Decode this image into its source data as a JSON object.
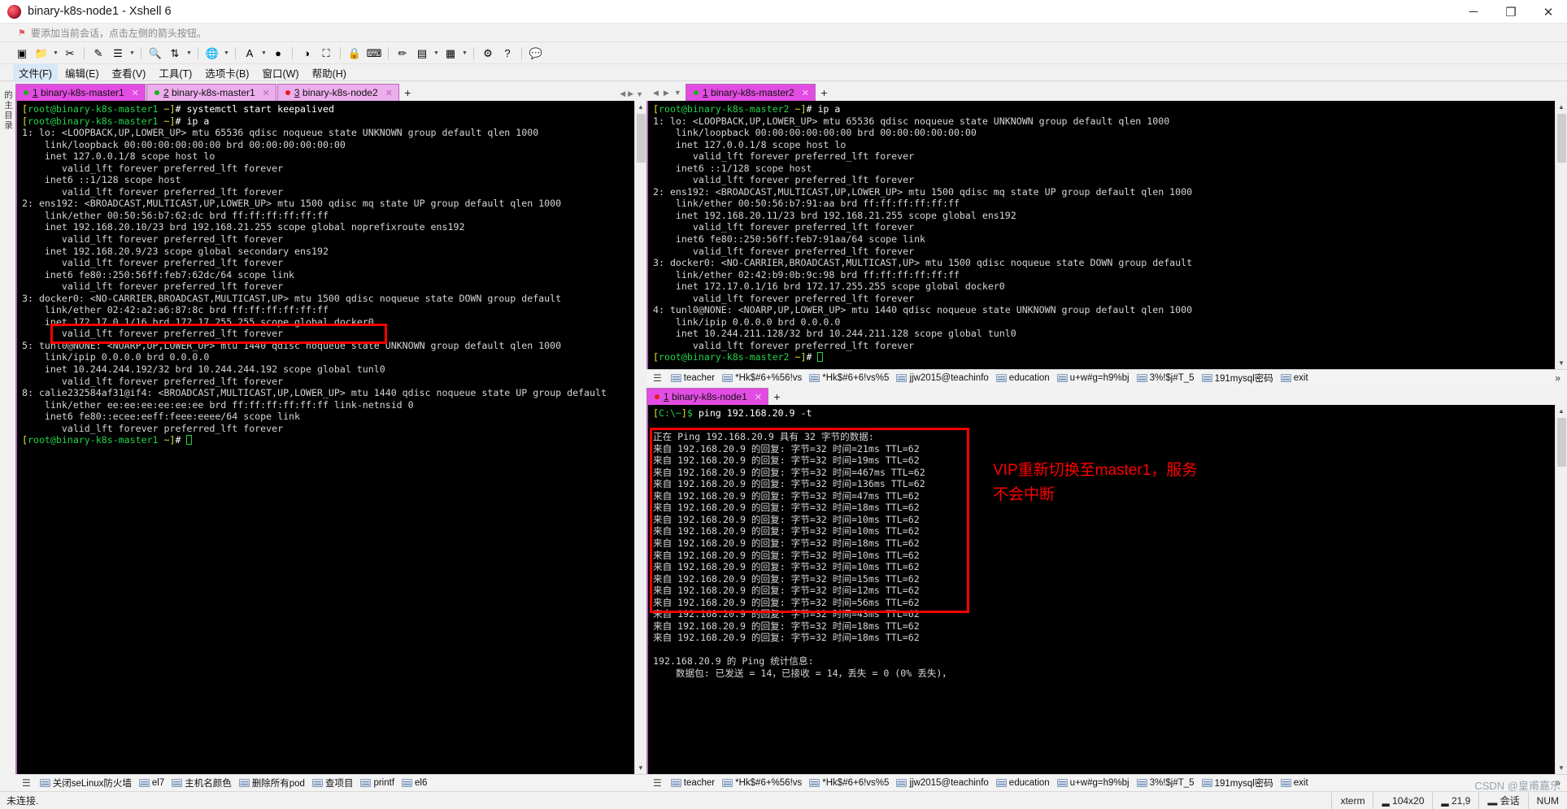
{
  "window": {
    "title": "binary-k8s-node1 - Xshell 6",
    "icon": "xshell-logo-icon",
    "minimize": "─",
    "maximize": "❐",
    "close": "✕"
  },
  "notice": {
    "icon": "red-flag-icon",
    "text": "要添加当前会话，点击左侧的箭头按钮。"
  },
  "toolbar": {
    "buttons": [
      {
        "name": "new-session",
        "glyph": "▣"
      },
      {
        "name": "open-folder",
        "glyph": "📁",
        "caret": true
      },
      {
        "name": "copy-session",
        "glyph": "✂"
      },
      {
        "name": "paste-session",
        "glyph": "✎"
      },
      {
        "name": "log-session",
        "glyph": "☰",
        "caret": true
      },
      {
        "name": "find",
        "glyph": "🔍"
      },
      {
        "name": "transfer-file",
        "glyph": "⇅",
        "caret": true
      },
      {
        "name": "global-tunnel",
        "glyph": "🌐",
        "caret": true
      },
      {
        "name": "font-size",
        "glyph": "A",
        "caret": true
      },
      {
        "name": "xshell",
        "glyph": "●"
      },
      {
        "name": "xftp",
        "glyph": "◑"
      },
      {
        "name": "fullscreen",
        "glyph": "⛶"
      },
      {
        "name": "lock",
        "glyph": "🔒"
      },
      {
        "name": "keyboard",
        "glyph": "⌨"
      },
      {
        "name": "highlight-pen",
        "glyph": "✏"
      },
      {
        "name": "compose",
        "glyph": "▤",
        "caret": true
      },
      {
        "name": "layout",
        "glyph": "▦",
        "caret": true
      },
      {
        "name": "settings",
        "glyph": "⚙"
      },
      {
        "name": "help",
        "glyph": "?"
      },
      {
        "name": "chat",
        "glyph": "💬"
      }
    ]
  },
  "menubar": {
    "items": [
      {
        "label": "文件(F)",
        "active": true
      },
      {
        "label": "编辑(E)",
        "active": false
      },
      {
        "label": "查看(V)",
        "active": false
      },
      {
        "label": "工具(T)",
        "active": false
      },
      {
        "label": "选项卡(B)",
        "active": false
      },
      {
        "label": "窗口(W)",
        "active": false
      },
      {
        "label": "帮助(H)",
        "active": false
      }
    ]
  },
  "vstrip": {
    "label": "的主目录"
  },
  "left_pane": {
    "tabs": [
      {
        "num": "1",
        "label": "binary-k8s-master1",
        "active": true,
        "dot": "green"
      },
      {
        "num": "2",
        "label": "binary-k8s-master1",
        "active": false,
        "dot": "green"
      },
      {
        "num": "3",
        "label": "binary-k8s-node2",
        "active": false,
        "dot": "red"
      }
    ],
    "add_label": "+",
    "nav_prev": "◀",
    "nav_next": "▶",
    "nav_menu": "▼",
    "prompt_user": "[root@binary-k8s-master1",
    "terminal_lines": [
      "[root@binary-k8s-master1 ~]# systemctl start keepalived",
      "[root@binary-k8s-master1 ~]# ip a",
      "1: lo: <LOOPBACK,UP,LOWER_UP> mtu 65536 qdisc noqueue state UNKNOWN group default qlen 1000",
      "    link/loopback 00:00:00:00:00:00 brd 00:00:00:00:00:00",
      "    inet 127.0.0.1/8 scope host lo",
      "       valid_lft forever preferred_lft forever",
      "    inet6 ::1/128 scope host",
      "       valid_lft forever preferred_lft forever",
      "2: ens192: <BROADCAST,MULTICAST,UP,LOWER_UP> mtu 1500 qdisc mq state UP group default qlen 1000",
      "    link/ether 00:50:56:b7:62:dc brd ff:ff:ff:ff:ff:ff",
      "    inet 192.168.20.10/23 brd 192.168.21.255 scope global noprefixroute ens192",
      "       valid_lft forever preferred_lft forever",
      "    inet 192.168.20.9/23 scope global secondary ens192",
      "       valid_lft forever preferred_lft forever",
      "    inet6 fe80::250:56ff:feb7:62dc/64 scope link",
      "       valid_lft forever preferred_lft forever",
      "3: docker0: <NO-CARRIER,BROADCAST,MULTICAST,UP> mtu 1500 qdisc noqueue state DOWN group default",
      "    link/ether 02:42:a2:a6:87:8c brd ff:ff:ff:ff:ff:ff",
      "    inet 172.17.0.1/16 brd 172.17.255.255 scope global docker0",
      "       valid_lft forever preferred_lft forever",
      "5: tunl0@NONE: <NOARP,UP,LOWER_UP> mtu 1440 qdisc noqueue state UNKNOWN group default qlen 1000",
      "    link/ipip 0.0.0.0 brd 0.0.0.0",
      "    inet 10.244.244.192/32 brd 10.244.244.192 scope global tunl0",
      "       valid_lft forever preferred_lft forever",
      "8: calie232584af31@if4: <BROADCAST,MULTICAST,UP,LOWER_UP> mtu 1440 qdisc noqueue state UP group default",
      "    link/ether ee:ee:ee:ee:ee:ee brd ff:ff:ff:ff:ff:ff link-netnsid 0",
      "    inet6 fe80::ecee:eeff:feee:eeee/64 scope link",
      "       valid_lft forever preferred_lft forever"
    ],
    "final_prompt": "[root@binary-k8s-master1 ~]# ",
    "quickbar": [
      {
        "label": "关闭seLinux防火墙"
      },
      {
        "label": "el7"
      },
      {
        "label": "主机名颜色"
      },
      {
        "label": "删除所有pod"
      },
      {
        "label": "查项目"
      },
      {
        "label": "printf"
      },
      {
        "label": "el6"
      }
    ]
  },
  "right_top_pane": {
    "tabs": [
      {
        "num": "1",
        "label": "binary-k8s-master2",
        "active": true,
        "dot": "green"
      }
    ],
    "add_label": "+",
    "nav_prev": "◀",
    "nav_next": "▶",
    "nav_menu": "▼",
    "terminal_lines": [
      "[root@binary-k8s-master2 ~]# ip a",
      "1: lo: <LOOPBACK,UP,LOWER_UP> mtu 65536 qdisc noqueue state UNKNOWN group default qlen 1000",
      "    link/loopback 00:00:00:00:00:00 brd 00:00:00:00:00:00",
      "    inet 127.0.0.1/8 scope host lo",
      "       valid_lft forever preferred_lft forever",
      "    inet6 ::1/128 scope host",
      "       valid_lft forever preferred_lft forever",
      "2: ens192: <BROADCAST,MULTICAST,UP,LOWER_UP> mtu 1500 qdisc mq state UP group default qlen 1000",
      "    link/ether 00:50:56:b7:91:aa brd ff:ff:ff:ff:ff:ff",
      "    inet 192.168.20.11/23 brd 192.168.21.255 scope global ens192",
      "       valid_lft forever preferred_lft forever",
      "    inet6 fe80::250:56ff:feb7:91aa/64 scope link",
      "       valid_lft forever preferred_lft forever",
      "3: docker0: <NO-CARRIER,BROADCAST,MULTICAST,UP> mtu 1500 qdisc noqueue state DOWN group default",
      "    link/ether 02:42:b9:0b:9c:98 brd ff:ff:ff:ff:ff:ff",
      "    inet 172.17.0.1/16 brd 172.17.255.255 scope global docker0",
      "       valid_lft forever preferred_lft forever",
      "4: tunl0@NONE: <NOARP,UP,LOWER_UP> mtu 1440 qdisc noqueue state UNKNOWN group default qlen 1000",
      "    link/ipip 0.0.0.0 brd 0.0.0.0",
      "    inet 10.244.211.128/32 brd 10.244.211.128 scope global tunl0",
      "       valid_lft forever preferred_lft forever"
    ],
    "final_prompt": "[root@binary-k8s-master2 ~]# ",
    "quickbar": [
      {
        "label": "teacher"
      },
      {
        "label": "*Hk$#6+%56!vs"
      },
      {
        "label": "*Hk$#6+6!vs%5"
      },
      {
        "label": "jjw2015@teachinfo"
      },
      {
        "label": "education"
      },
      {
        "label": "u+w#g=h9%bj"
      },
      {
        "label": "3%!$j#T_5"
      },
      {
        "label": "191mysql密码"
      },
      {
        "label": "exit"
      }
    ],
    "quickbar_more": "»"
  },
  "right_bottom_pane": {
    "tabs": [
      {
        "num": "1",
        "label": "binary-k8s-node1",
        "active": true,
        "dot": "red"
      }
    ],
    "add_label": "+",
    "nav_prev": "◀",
    "nav_next": "▶",
    "nav_menu": "▼",
    "prompt_line": "[C:\\~]$ ping 192.168.20.9 -t",
    "ping_lines": [
      "正在 Ping 192.168.20.9 具有 32 字节的数据:",
      "来自 192.168.20.9 的回复: 字节=32 时间=21ms TTL=62",
      "来自 192.168.20.9 的回复: 字节=32 时间=19ms TTL=62",
      "来自 192.168.20.9 的回复: 字节=32 时间=467ms TTL=62",
      "来自 192.168.20.9 的回复: 字节=32 时间=136ms TTL=62",
      "来自 192.168.20.9 的回复: 字节=32 时间=47ms TTL=62",
      "来自 192.168.20.9 的回复: 字节=32 时间=18ms TTL=62",
      "来自 192.168.20.9 的回复: 字节=32 时间=10ms TTL=62",
      "来自 192.168.20.9 的回复: 字节=32 时间=10ms TTL=62",
      "来自 192.168.20.9 的回复: 字节=32 时间=18ms TTL=62",
      "来自 192.168.20.9 的回复: 字节=32 时间=10ms TTL=62",
      "来自 192.168.20.9 的回复: 字节=32 时间=10ms TTL=62",
      "来自 192.168.20.9 的回复: 字节=32 时间=15ms TTL=62",
      "来自 192.168.20.9 的回复: 字节=32 时间=12ms TTL=62",
      "来自 192.168.20.9 的回复: 字节=32 时间=56ms TTL=62",
      "来自 192.168.20.9 的回复: 字节=32 时间=43ms TTL=62",
      "来自 192.168.20.9 的回复: 字节=32 时间=18ms TTL=62",
      "来自 192.168.20.9 的回复: 字节=32 时间=18ms TTL=62"
    ],
    "stats_lines": [
      "192.168.20.9 的 Ping 统计信息:",
      "    数据包: 已发送 = 14，已接收 = 14，丢失 = 0 (0% 丢失)，"
    ],
    "quickbar": [
      {
        "label": "teacher"
      },
      {
        "label": "*Hk$#6+%56!vs"
      },
      {
        "label": "*Hk$#6+6!vs%5"
      },
      {
        "label": "jjw2015@teachinfo"
      },
      {
        "label": "education"
      },
      {
        "label": "u+w#g=h9%bj"
      },
      {
        "label": "3%!$j#T_5"
      },
      {
        "label": "191mysql密码"
      },
      {
        "label": "exit"
      }
    ],
    "quickbar_more": "»"
  },
  "annotation": {
    "text": "VIP重新切换至master1，服务\n不会中断",
    "color": "#ff0000"
  },
  "statusbar": {
    "left": "未连接.",
    "cells": [
      "xterm",
      "▂ 104x20",
      "▂ 21,9",
      "▂ 会话",
      "NUM"
    ]
  },
  "watermark": "CSDN @皇甫嘉乐",
  "colors": {
    "tab_active": "#e24ce2",
    "tab_inactive": "#ecaeec",
    "terminal_bg": "#000000",
    "prompt_bracket": "#e2e234",
    "prompt_user": "#24d24b",
    "highlight_red": "#ff0000"
  }
}
